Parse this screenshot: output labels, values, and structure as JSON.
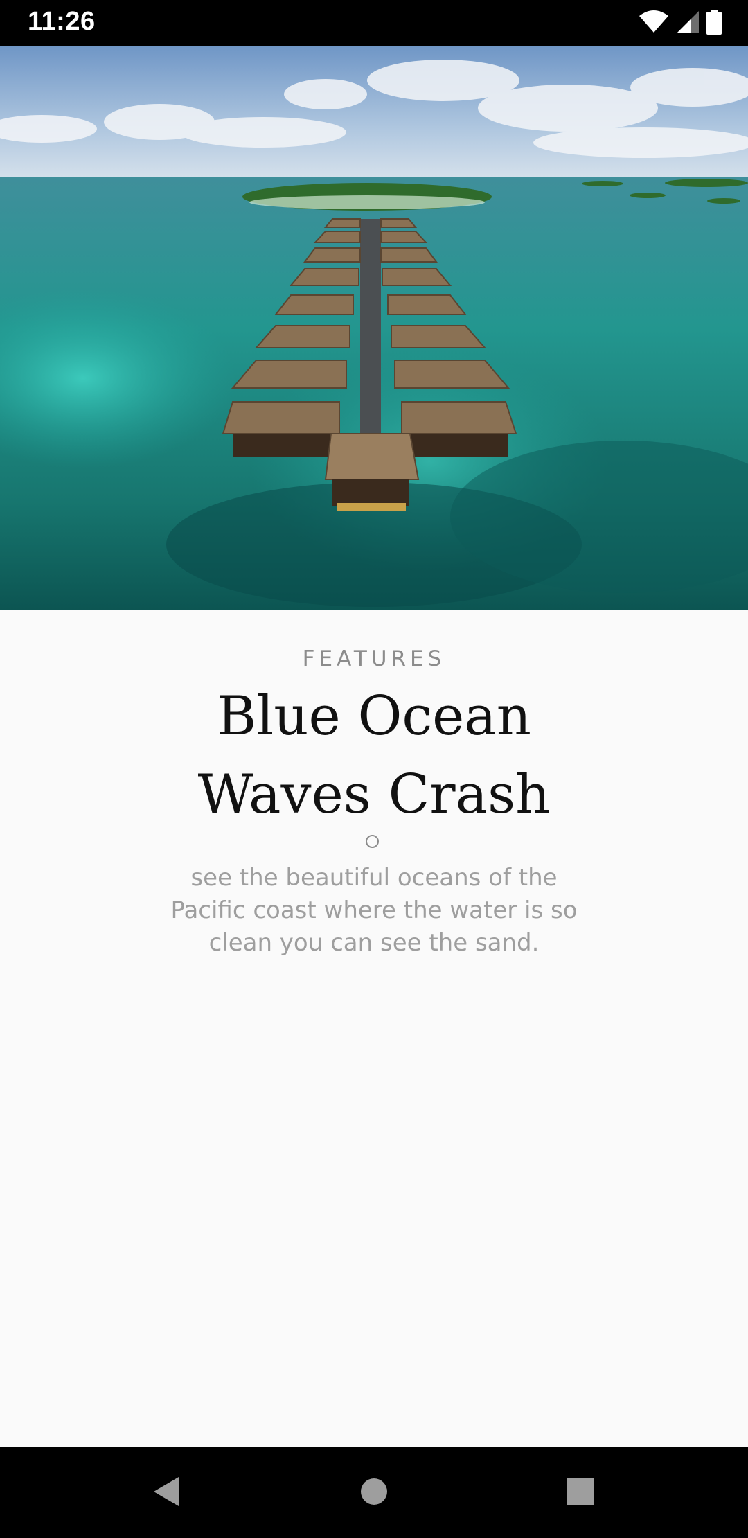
{
  "status_bar": {
    "time": "11:26",
    "icons": [
      "wifi-icon",
      "cellular-signal-icon",
      "battery-icon"
    ]
  },
  "hero": {
    "image": "overwater-bungalows-aerial-photo"
  },
  "article": {
    "kicker": "FEATURES",
    "title": "Blue Ocean Waves Crash",
    "description": "see the beautiful oceans of the Pacific coast where the water is so clean you can see the sand."
  },
  "nav_bar": {
    "buttons": [
      "back-icon",
      "home-icon",
      "recents-icon"
    ]
  },
  "colors": {
    "background": "#fafafa",
    "title": "#111111",
    "muted": "#9e9e9e",
    "bars": "#000000"
  }
}
